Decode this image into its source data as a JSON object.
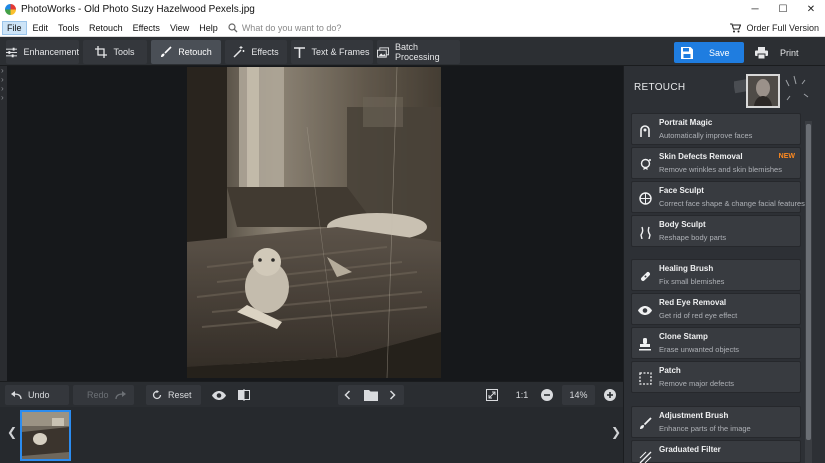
{
  "window": {
    "title": "PhotoWorks - Old Photo Suzy Hazelwood Pexels.jpg",
    "minimize": "─",
    "maximize": "☐",
    "close": "✕"
  },
  "menu": {
    "items": [
      "File",
      "Edit",
      "Tools",
      "Retouch",
      "Effects",
      "View",
      "Help"
    ],
    "search_placeholder": "What do you want to do?",
    "order_label": "Order Full Version"
  },
  "tabs": [
    {
      "label": "Enhancement",
      "icon": "sliders-icon"
    },
    {
      "label": "Tools",
      "icon": "crop-icon"
    },
    {
      "label": "Retouch",
      "icon": "brush-icon"
    },
    {
      "label": "Effects",
      "icon": "magic-wand-icon"
    },
    {
      "label": "Text & Frames",
      "icon": "text-icon"
    },
    {
      "label": "Batch Processing",
      "icon": "images-icon"
    }
  ],
  "actions": {
    "save": "Save",
    "print": "Print"
  },
  "bottom": {
    "undo": "Undo",
    "redo": "Redo",
    "reset": "Reset",
    "ratio": "1:1",
    "zoom": "14%"
  },
  "panel": {
    "title": "RETOUCH",
    "items": [
      {
        "title": "Portrait Magic",
        "desc": "Automatically improve faces",
        "icon": "portrait-magic-icon"
      },
      {
        "title": "Skin Defects Removal",
        "desc": "Remove wrinkles and skin blemishes",
        "icon": "skin-defects-icon",
        "badge": "NEW"
      },
      {
        "title": "Face Sculpt",
        "desc": "Correct face shape & change facial features",
        "icon": "face-sculpt-icon"
      },
      {
        "title": "Body Sculpt",
        "desc": "Reshape body parts",
        "icon": "body-sculpt-icon"
      },
      {
        "title": "Healing Brush",
        "desc": "Fix small blemishes",
        "icon": "bandage-icon"
      },
      {
        "title": "Red Eye Removal",
        "desc": "Get rid of red eye effect",
        "icon": "eye-icon"
      },
      {
        "title": "Clone Stamp",
        "desc": "Erase unwanted objects",
        "icon": "stamp-icon"
      },
      {
        "title": "Patch",
        "desc": "Remove major defects",
        "icon": "patch-icon"
      },
      {
        "title": "Adjustment Brush",
        "desc": "Enhance parts of the image",
        "icon": "adjustment-brush-icon"
      },
      {
        "title": "Graduated Filter",
        "desc": "",
        "icon": "graduated-filter-icon"
      }
    ]
  }
}
